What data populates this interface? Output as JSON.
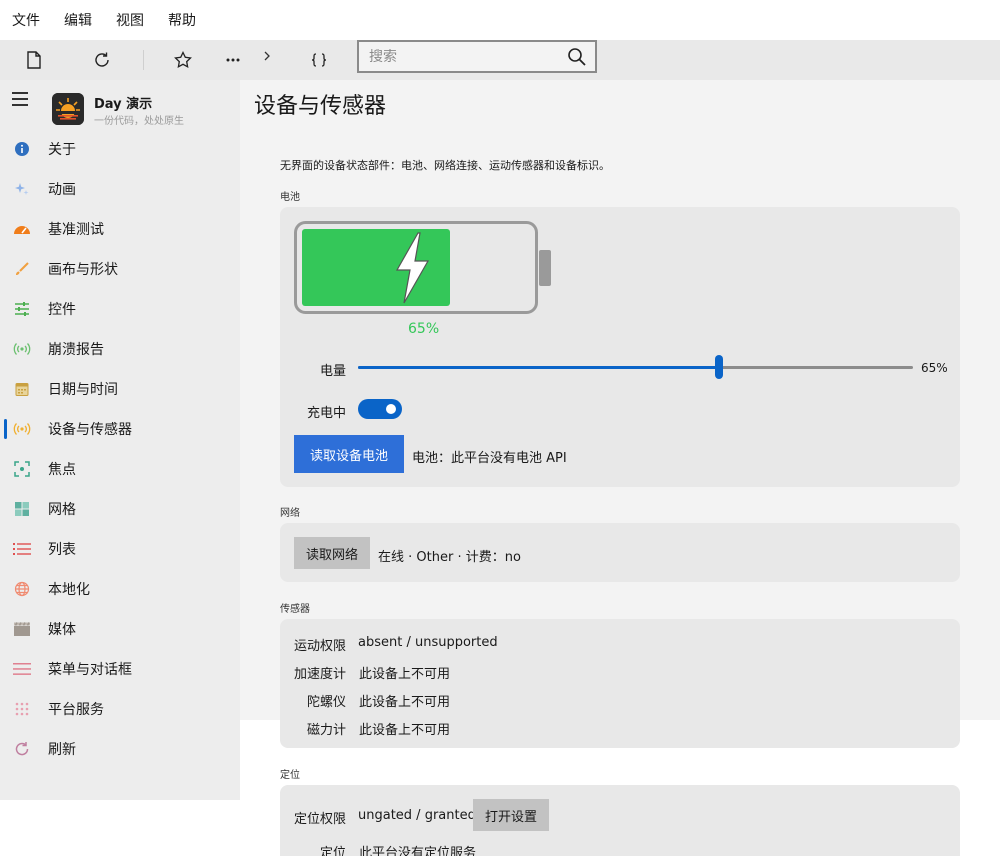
{
  "menubar": {
    "items": [
      "文件",
      "编辑",
      "视图",
      "帮助"
    ]
  },
  "search": {
    "placeholder": "搜索"
  },
  "app": {
    "title": "Day 演示",
    "subtitle": "一份代码，处处原生"
  },
  "sidebar": {
    "items": [
      {
        "label": "关于",
        "icon": "info-icon",
        "color": "#2f6fbf"
      },
      {
        "label": "动画",
        "icon": "sparkle-icon",
        "color": "#8fb3e8"
      },
      {
        "label": "基准测试",
        "icon": "speedometer-icon",
        "color": "#f07d1a"
      },
      {
        "label": "画布与形状",
        "icon": "brush-icon",
        "color": "#f0a040"
      },
      {
        "label": "控件",
        "icon": "sliders-icon",
        "color": "#4caf50"
      },
      {
        "label": "崩溃报告",
        "icon": "broadcast-icon",
        "color": "#6cc070"
      },
      {
        "label": "日期与时间",
        "icon": "calendar-icon",
        "color": "#c9a040"
      },
      {
        "label": "设备与传感器",
        "icon": "sensor-icon",
        "color": "#f0b030"
      },
      {
        "label": "焦点",
        "icon": "focus-icon",
        "color": "#3aa58a"
      },
      {
        "label": "网格",
        "icon": "grid-icon",
        "color": "#5fb0a0"
      },
      {
        "label": "列表",
        "icon": "list-icon",
        "color": "#e05050"
      },
      {
        "label": "本地化",
        "icon": "globe-icon",
        "color": "#f08a70"
      },
      {
        "label": "媒体",
        "icon": "clapper-icon",
        "color": "#a09890"
      },
      {
        "label": "菜单与对话框",
        "icon": "menu-icon",
        "color": "#e08090"
      },
      {
        "label": "平台服务",
        "icon": "dots-grid-icon",
        "color": "#e8a0b0"
      },
      {
        "label": "刷新",
        "icon": "refresh-icon",
        "color": "#c080a0"
      }
    ],
    "active_index": 7
  },
  "page": {
    "title": "设备与传感器",
    "description": "无界面的设备状态部件：电池、网络连接、运动传感器和设备标识。"
  },
  "battery": {
    "section_label": "电池",
    "level_percent": 65,
    "level_text": "65%",
    "level_label": "电量",
    "charging_label": "充电中",
    "charging": true,
    "read_button": "读取设备电池",
    "status_text": "电池：此平台没有电池 API",
    "fill_color": "#34c759"
  },
  "network": {
    "section_label": "网络",
    "read_button": "读取网络",
    "status_text": "在线 · Other · 计费：no"
  },
  "sensors": {
    "section_label": "传感器",
    "rows": [
      {
        "label": "运动权限",
        "value": "absent / unsupported"
      },
      {
        "label": "加速度计",
        "value": "此设备上不可用"
      },
      {
        "label": "陀螺仪",
        "value": "此设备上不可用"
      },
      {
        "label": "磁力计",
        "value": "此设备上不可用"
      }
    ]
  },
  "location": {
    "section_label": "定位",
    "permission_label": "定位权限",
    "permission_value": "ungated / granted",
    "open_settings_button": "打开设置",
    "location_label": "定位",
    "location_value": "此平台没有定位服务"
  },
  "colors": {
    "accent": "#0a64c8",
    "primary_button": "#2e6fd8"
  }
}
